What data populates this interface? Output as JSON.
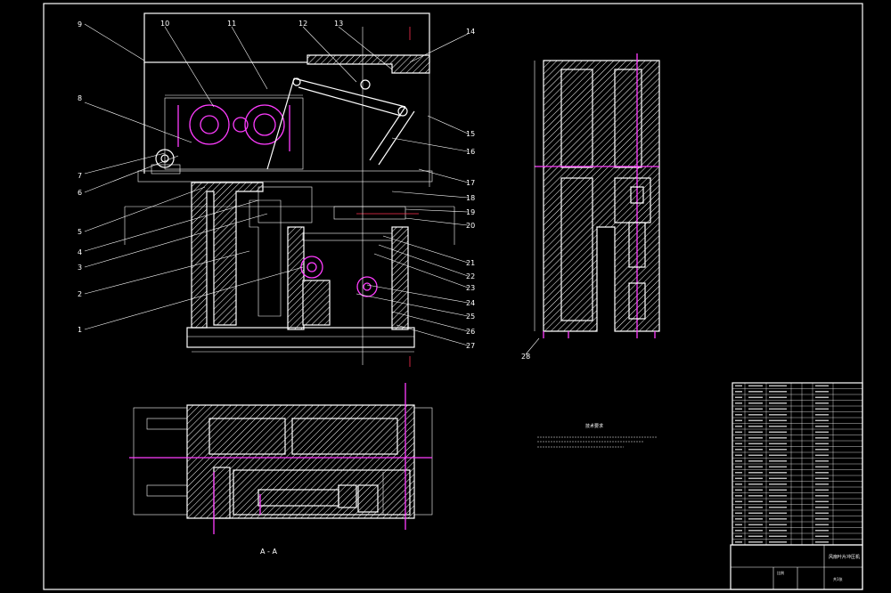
{
  "drawing": {
    "section_label": "A - A",
    "callouts_left": [
      "9",
      "8",
      "7",
      "6",
      "5",
      "4",
      "3",
      "2",
      "1"
    ],
    "callouts_top": [
      "10",
      "11",
      "12",
      "13",
      "14"
    ],
    "callouts_right": [
      "15",
      "16",
      "17",
      "18",
      "19",
      "20",
      "21",
      "22",
      "23",
      "24",
      "25",
      "26",
      "27"
    ],
    "side_view_callout": "28",
    "tech_req_title": "技术要求",
    "title_block": {
      "drawing_title": "风扇叶片冲压机",
      "scale_field": "比例",
      "sheet_label": "共1张"
    }
  },
  "colors": {
    "background": "#000000",
    "line": "#ffffff",
    "highlight": "#ff3cff",
    "centerline": "#ff3050"
  }
}
